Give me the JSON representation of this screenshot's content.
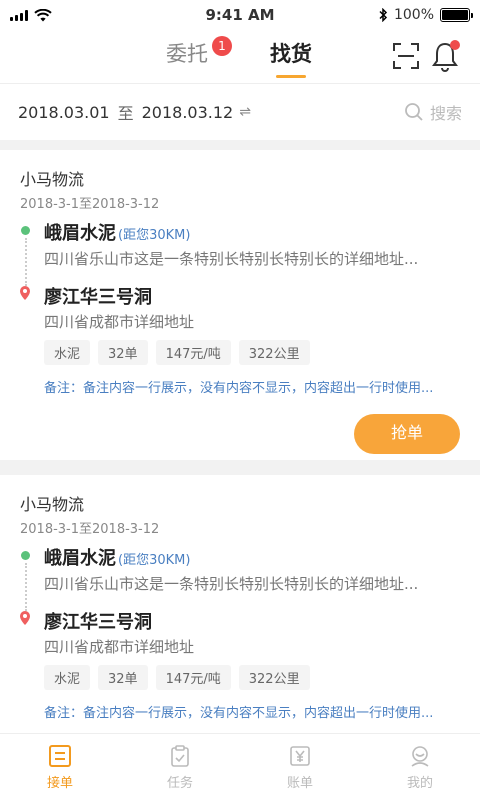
{
  "status_bar": {
    "time": "9:41 AM",
    "battery": "100%",
    "battery_level": 1.0
  },
  "top_nav": {
    "tabs": [
      {
        "label": "委托",
        "badge": "1",
        "active": false
      },
      {
        "label": "找货",
        "active": true
      }
    ],
    "icons": [
      "scan-icon",
      "bell-icon"
    ]
  },
  "filter": {
    "start_date": "2018.03.01",
    "to_label": "至",
    "end_date": "2018.03.12",
    "swap_icon": "⇌",
    "search_placeholder": "搜索"
  },
  "orders": [
    {
      "company": "小马物流",
      "dates": "2018-3-1至2018-3-12",
      "origin": "峨眉水泥",
      "distance": "(距您30KM)",
      "origin_address": "四川省乐山市这是一条特别长特别长特别长的详细地址...",
      "destination": "廖江华三号洞",
      "destination_address": "四川省成都市详细地址",
      "tags": [
        "水泥",
        "32单",
        "147元/吨",
        "322公里"
      ],
      "note": "备注：备注内容一行展示，没有内容不显示，内容超出一行时使用...",
      "action": "抢单"
    },
    {
      "company": "小马物流",
      "dates": "2018-3-1至2018-3-12",
      "origin": "峨眉水泥",
      "distance": "(距您30KM)",
      "origin_address": "四川省乐山市这是一条特别长特别长特别长的详细地址...",
      "destination": "廖江华三号洞",
      "destination_address": "四川省成都市详细地址",
      "tags": [
        "水泥",
        "32单",
        "147元/吨",
        "322公里"
      ],
      "note": "备注：备注内容一行展示，没有内容不显示，内容超出一行时使用..."
    }
  ],
  "bottom_tabs": [
    {
      "label": "接单",
      "icon": "list-icon",
      "active": true
    },
    {
      "label": "任务",
      "icon": "clipboard-icon",
      "active": false
    },
    {
      "label": "账单",
      "icon": "bill-icon",
      "active": false
    },
    {
      "label": "我的",
      "icon": "profile-icon",
      "active": false
    }
  ],
  "colors": {
    "accent": "#f8a53a",
    "badge": "#ef4b4b",
    "link": "#4a7fc1",
    "origin": "#5bc27b"
  }
}
